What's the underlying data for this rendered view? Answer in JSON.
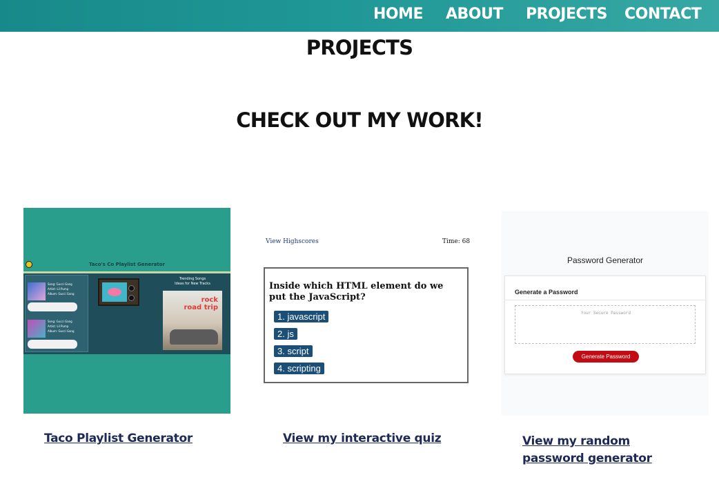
{
  "nav": {
    "items": [
      {
        "label": "HOME"
      },
      {
        "label": "ABOUT"
      },
      {
        "label": "PROJECTS"
      },
      {
        "label": "CONTACT"
      }
    ]
  },
  "page": {
    "title": "PROJECTS",
    "subtitle": "CHECK OUT MY WORK!"
  },
  "projects": [
    {
      "link_label": "Taco Playlist Generator",
      "preview": {
        "app_title": "Taco's Co Playlist Generator",
        "songs": [
          {
            "song": "Song: Gucci Gang",
            "artist": "Artist: Lil Pump",
            "album": "Album: Gucci Gang"
          },
          {
            "song": "Song: Gucci Gang",
            "artist": "Artist: Lil Pump",
            "album": "Album: Gucci Gang"
          }
        ],
        "trending_heading": "Trending Songs",
        "trending_sub": "Ideas for New Tracks",
        "album_word_1": "rock",
        "album_word_2": "road trip"
      }
    },
    {
      "link_label": "View my interactive quiz",
      "preview": {
        "highscores_link": "View Highscores",
        "timer": "Time: 68",
        "question": "Inside which HTML element do we put the JavaScript?",
        "choices": [
          "1. javascript",
          "2. js",
          "3. script",
          "4. scripting"
        ]
      }
    },
    {
      "link_label": "View my random password generator",
      "preview": {
        "title": "Password Generator",
        "card_title": "Generate a Password",
        "placeholder": "Your Secure Password",
        "button_label": "Generate Password",
        "button_color": "#c20b13"
      }
    }
  ],
  "colors": {
    "nav_start": "#18898a",
    "nav_end": "#37a8a4",
    "link": "#1e2a55"
  }
}
